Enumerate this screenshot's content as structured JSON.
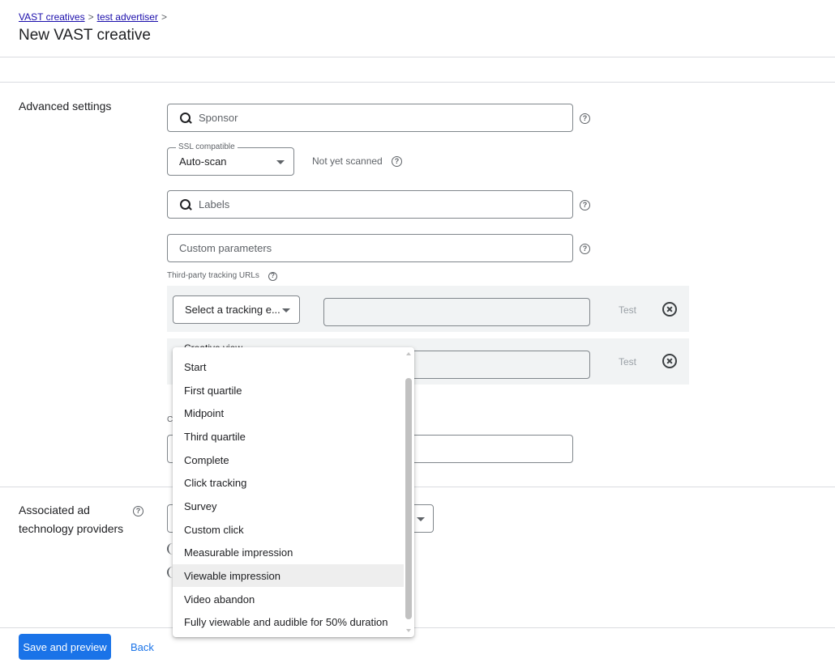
{
  "breadcrumb": {
    "items": [
      "VAST creatives",
      "test advertiser"
    ],
    "separator": ">"
  },
  "page_title": "New VAST creative",
  "advanced_settings": {
    "label": "Advanced settings",
    "sponsor_placeholder": "Sponsor",
    "ssl": {
      "label": "SSL compatible",
      "value": "Auto-scan",
      "status": "Not yet scanned"
    },
    "labels_placeholder": "Labels",
    "custom_parameters_placeholder": "Custom parameters",
    "tracking_urls_label": "Third-party tracking URLs",
    "tracking_rows": [
      {
        "event_value": "Select a tracking e...",
        "test_label": "Test"
      },
      {
        "event_value": "Creative view",
        "test_label": "Test"
      }
    ],
    "partial_label": "C"
  },
  "associated_providers": {
    "label_line1": "Associated ad",
    "label_line2": "technology providers"
  },
  "tracking_event_dropdown": {
    "options": [
      "Start",
      "First quartile",
      "Midpoint",
      "Third quartile",
      "Complete",
      "Click tracking",
      "Survey",
      "Custom click",
      "Measurable impression",
      "Viewable impression",
      "Video abandon",
      "Fully viewable and audible for 50% duration"
    ],
    "hovered": "Viewable impression"
  },
  "footer": {
    "save_label": "Save and preview",
    "back_label": "Back"
  },
  "colors": {
    "primary": "#1a73e8",
    "link": "#1a0dab",
    "row_background": "#f1f3f4"
  }
}
